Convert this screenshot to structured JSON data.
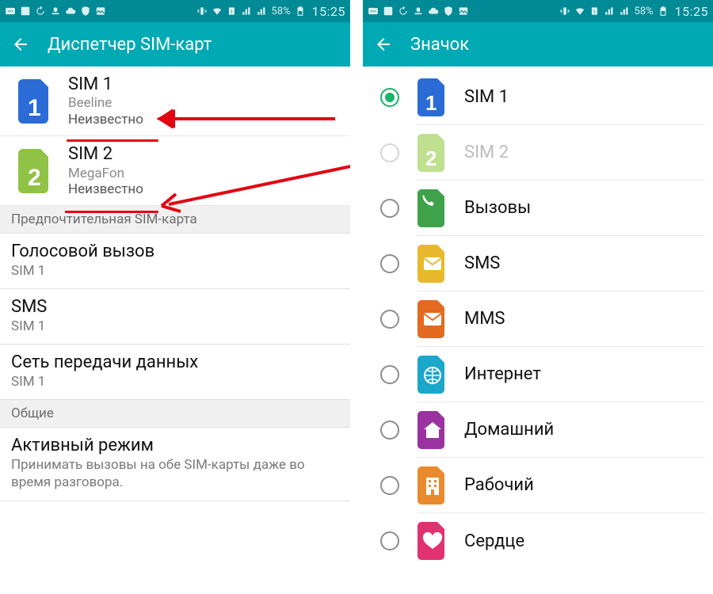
{
  "status": {
    "battery": "58%",
    "time": "15:25"
  },
  "left": {
    "title": "Диспетчер SIM-карт",
    "sims": [
      {
        "name": "SIM 1",
        "carrier": "Beeline",
        "status": "Неизвестно",
        "color": "#2a6bd6",
        "digit": "1"
      },
      {
        "name": "SIM 2",
        "carrier": "MegaFon",
        "status": "Неизвестно",
        "color": "#8fc245",
        "digit": "2"
      }
    ],
    "section_preferred": "Предпочтительная SIM-карта",
    "settings": [
      {
        "label": "Голосовой вызов",
        "sub": "SIM 1"
      },
      {
        "label": "SMS",
        "sub": "SIM 1"
      },
      {
        "label": "Сеть передачи данных",
        "sub": "SIM 1"
      }
    ],
    "section_general": "Общие",
    "active_mode": {
      "label": "Активный режим",
      "desc": "Принимать вызовы на обе SIM-карты даже во время разговора."
    }
  },
  "right": {
    "title": "Значок",
    "options": [
      {
        "label": "SIM 1",
        "color": "#2a6bd6",
        "digit": "1",
        "selected": true
      },
      {
        "label": "SIM 2",
        "color": "#bfe08f",
        "digit": "2",
        "disabled": true
      },
      {
        "label": "Вызовы",
        "color": "#3fa24a",
        "glyph": "phone"
      },
      {
        "label": "SMS",
        "color": "#e7b82c",
        "glyph": "envelope"
      },
      {
        "label": "MMS",
        "color": "#e36a20",
        "glyph": "envelope"
      },
      {
        "label": "Интернет",
        "color": "#1aa7c9",
        "glyph": "globe"
      },
      {
        "label": "Домашний",
        "color": "#9a32a0",
        "glyph": "home"
      },
      {
        "label": "Рабочий",
        "color": "#e98a2e",
        "glyph": "building"
      },
      {
        "label": "Сердце",
        "color": "#e0326f",
        "glyph": "heart"
      }
    ]
  }
}
